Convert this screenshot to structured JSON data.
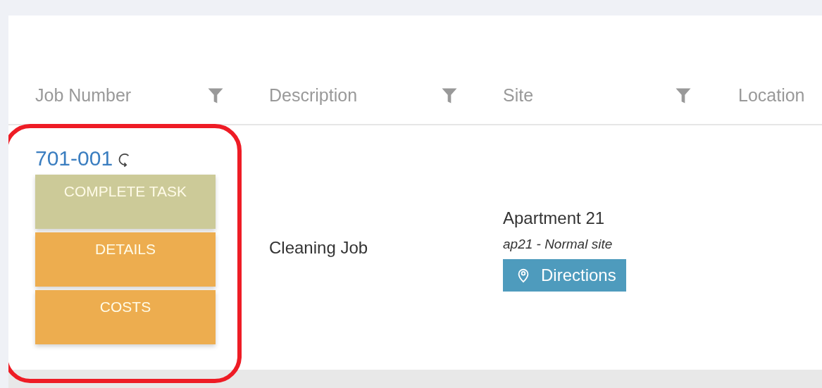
{
  "table": {
    "columns": [
      {
        "label": "Job Number",
        "filter": true
      },
      {
        "label": "Description",
        "filter": true
      },
      {
        "label": "Site",
        "filter": true
      },
      {
        "label": "Location",
        "filter": false
      }
    ],
    "rows": [
      {
        "job_number": "701-001",
        "highlighted": true,
        "actions": [
          {
            "label": "COMPLETE TASK",
            "kind": "complete"
          },
          {
            "label": "DETAILS",
            "kind": "primary"
          },
          {
            "label": "COSTS",
            "kind": "primary"
          }
        ],
        "description": "Cleaning Job",
        "site": {
          "name": "Apartment 21",
          "subtitle": "ap21 - Normal site",
          "directions": "Directions"
        }
      }
    ]
  }
}
